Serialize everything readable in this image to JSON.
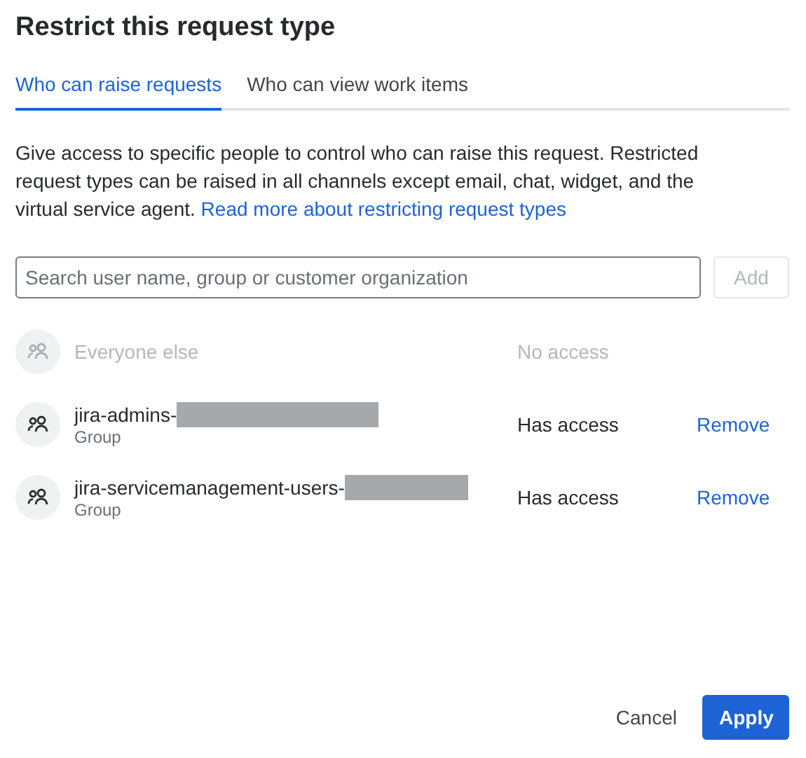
{
  "dialog": {
    "title": "Restrict this request type"
  },
  "tabs": [
    {
      "label": "Who can raise requests",
      "selected": true
    },
    {
      "label": "Who can view work items",
      "selected": false
    }
  ],
  "description": "Give access to specific people to control who can raise this request. Restricted request types can be raised in all channels except email, chat, widget, and the virtual service agent.",
  "description_link": "Read more about restricting request types",
  "search": {
    "placeholder": "Search user name, group or customer organization"
  },
  "add_button": {
    "label": "Add",
    "disabled": true
  },
  "entries": [
    {
      "name": "Everyone else",
      "access": "No access",
      "disabled": true
    },
    {
      "name": "jira-admins-",
      "type": "Group",
      "access": "Has access",
      "action": "Remove",
      "disabled": false,
      "redacted": true
    },
    {
      "name": "jira-servicemanagement-users-",
      "type": "Group",
      "access": "Has access",
      "action": "Remove",
      "disabled": false,
      "redacted": true
    }
  ],
  "footer": {
    "buttons": [
      {
        "label": "Cancel",
        "kind": "subtle"
      },
      {
        "label": "Apply",
        "kind": "primary"
      }
    ]
  }
}
